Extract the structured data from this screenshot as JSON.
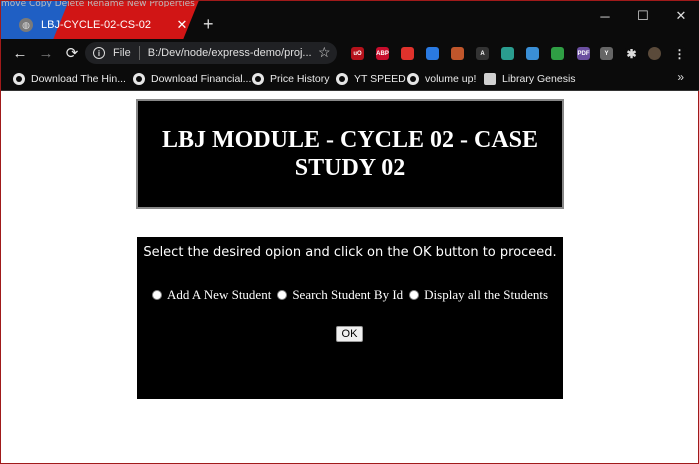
{
  "browser": {
    "top_strip_text": "move  Copy  Delete  Rename  New  Properties",
    "tab": {
      "title": "LBJ-CYCLE-02-CS-02",
      "close": "✕"
    },
    "new_tab": "+",
    "window_controls": {
      "minimize": "─",
      "maximize": "☐",
      "close": "✕"
    },
    "toolbar": {
      "back": "←",
      "forward": "→",
      "reload": "⟳",
      "info": "i",
      "scheme": "File",
      "url": "B:/Dev/node/express-demo/proj...",
      "star": "☆"
    },
    "extensions": [
      {
        "name": "ublock-icon",
        "label": "uO",
        "color": "#b5121b"
      },
      {
        "name": "adblock-plus-icon",
        "label": "ABP",
        "color": "#c70d2c"
      },
      {
        "name": "red-drop-icon",
        "label": "",
        "color": "#e0322c"
      },
      {
        "name": "blue-ext-icon",
        "label": "",
        "color": "#2a7ae2"
      },
      {
        "name": "cookie-icon",
        "label": "",
        "color": "#c0562b"
      },
      {
        "name": "a-ext-icon",
        "label": "A",
        "color": "#333333"
      },
      {
        "name": "color-ext-icon",
        "label": "",
        "color": "#2a9d8f"
      },
      {
        "name": "diamond-ext-icon",
        "label": "",
        "color": "#3a8fd6"
      },
      {
        "name": "green-ext-icon",
        "label": "",
        "color": "#2f9e44"
      },
      {
        "name": "pdf-ext-icon",
        "label": "PDF",
        "color": "#6b4fa0"
      },
      {
        "name": "y-ext-icon",
        "label": "Y",
        "color": "#666666"
      },
      {
        "name": "puzzle-icon",
        "label": "✱",
        "color": "#0b0b0b"
      },
      {
        "name": "profile-avatar",
        "label": "",
        "color": "#5a4a3a"
      },
      {
        "name": "menu-icon",
        "label": "⋮",
        "color": "#0b0b0b"
      }
    ],
    "bookmarks": [
      {
        "label": "Download The Hin..."
      },
      {
        "label": "Download Financial..."
      },
      {
        "label": "Price History"
      },
      {
        "label": "YT SPEED"
      },
      {
        "label": "volume up!"
      },
      {
        "label": "Library Genesis"
      }
    ],
    "bookmarks_more": "»"
  },
  "page": {
    "heading": "LBJ MODULE - CYCLE 02 - CASE STUDY 02",
    "prompt": "Select the desired opion and click on the OK button to proceed.",
    "options": [
      "Add A New Student",
      "Search Student By Id",
      "Display all the Students"
    ],
    "ok_label": "OK"
  }
}
